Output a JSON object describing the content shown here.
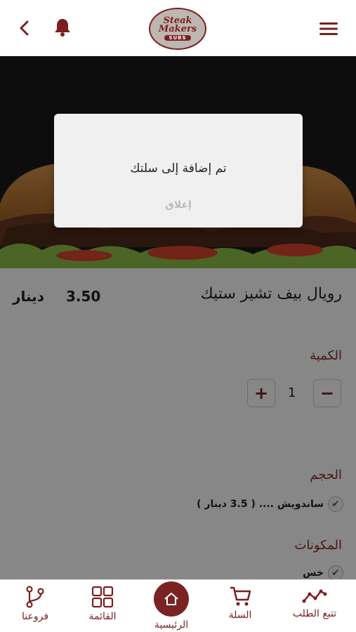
{
  "header": {
    "logo_line1": "Steak",
    "logo_line2": "Makers",
    "logo_sub": "SUBS"
  },
  "product": {
    "name": "رويال بيف تشيز ستيك",
    "price": "3.50",
    "currency": "دينار"
  },
  "quantity": {
    "label": "الكمية",
    "value": "1",
    "plus": "+",
    "minus": "−"
  },
  "size": {
    "label": "الحجم",
    "option": "ساندويش .... ( 3.5 دينار )"
  },
  "ingredients": {
    "label": "المكونات",
    "option": "خس"
  },
  "dialog": {
    "message": "تم إضافة إلى سلتك",
    "close_label": "إغلاق"
  },
  "nav": {
    "track": "تتبع الطلب",
    "cart": "السلة",
    "home": "الرئيسية",
    "menu": "القائمة",
    "branches": "فروعنا"
  },
  "colors": {
    "brand": "#7a1f1f",
    "overlay": "rgba(0,0,0,0.47)"
  },
  "icons": {
    "back": "chevron-left-icon",
    "bell": "bell-icon",
    "menu": "hamburger-icon",
    "home": "home-icon",
    "cart": "cart-icon",
    "grid": "grid-icon",
    "branches": "branch-icon",
    "track": "line-chart-icon"
  }
}
